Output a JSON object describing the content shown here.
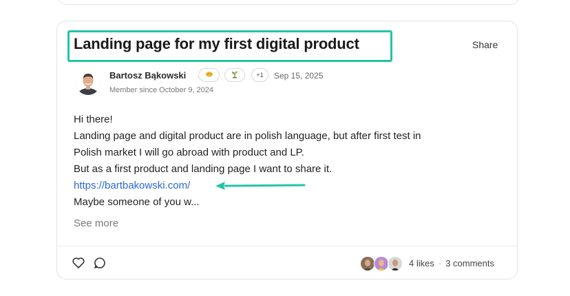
{
  "post": {
    "title": "Landing page for my first digital product",
    "share_label": "Share",
    "author": {
      "name": "Bartosz Bąkowski",
      "member_since": "Member since October 9, 2024",
      "badges": [
        {
          "icon": "handshake-icon",
          "color": "#f2b632"
        },
        {
          "icon": "sprout-icon",
          "color": "#7a9b3a"
        },
        {
          "text": "+1"
        }
      ],
      "date": "Sep 15, 2025"
    },
    "body_lines": [
      "Hi there!",
      "Landing page and digital product are in polish language, but after first test in",
      "Polish market I will go abroad with product and LP.",
      "But as a first product and landing page I want to share it."
    ],
    "link": "https://bartbakowski.com/",
    "truncated_line": "Maybe someone of you w...",
    "see_more": "See more",
    "likes": "4 likes",
    "comments": "3 comments"
  },
  "colors": {
    "highlight": "#22c4a6",
    "link": "#2b67d6"
  }
}
